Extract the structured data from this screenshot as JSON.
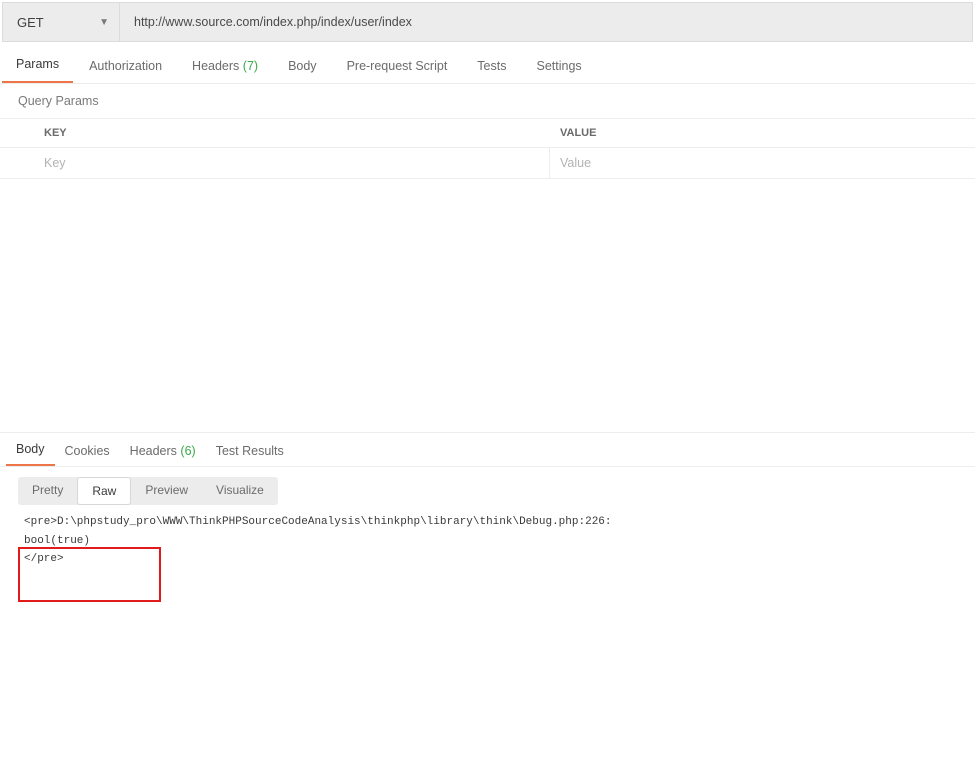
{
  "request": {
    "method": "GET",
    "url": "http://www.source.com/index.php/index/user/index"
  },
  "request_tabs": {
    "params": "Params",
    "authorization": "Authorization",
    "headers_label": "Headers",
    "headers_count": "(7)",
    "body": "Body",
    "pre_request": "Pre-request Script",
    "tests": "Tests",
    "settings": "Settings"
  },
  "query_params": {
    "title": "Query Params",
    "key_header": "KEY",
    "value_header": "VALUE",
    "key_placeholder": "Key",
    "value_placeholder": "Value"
  },
  "response_tabs": {
    "body": "Body",
    "cookies": "Cookies",
    "headers_label": "Headers",
    "headers_count": "(6)",
    "tests": "Test Results"
  },
  "view_modes": {
    "pretty": "Pretty",
    "raw": "Raw",
    "preview": "Preview",
    "visualize": "Visualize"
  },
  "response_body": {
    "line1": "<pre>D:\\phpstudy_pro\\WWW\\ThinkPHPSourceCodeAnalysis\\thinkphp\\library\\think\\Debug.php:226:",
    "line2": "bool(true)",
    "line3": "</pre>"
  }
}
